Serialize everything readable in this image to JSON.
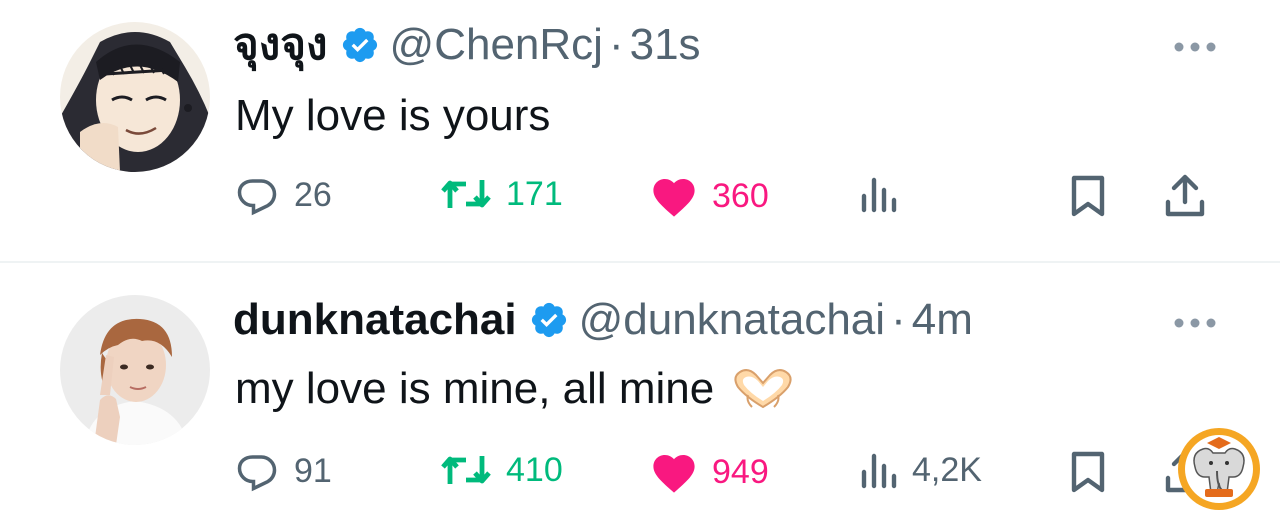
{
  "tweets": [
    {
      "display_name": "จุงจุง",
      "handle": "@ChenRcj",
      "separator": "·",
      "time": "31s",
      "text": "My love is yours",
      "replies": "26",
      "retweets": "171",
      "likes": "360",
      "views": "",
      "liked": true,
      "retweeted": true
    },
    {
      "display_name": "dunknatachai",
      "handle": "@dunknatachai",
      "separator": "·",
      "time": "4m",
      "text": "my love is mine, all mine",
      "emoji": "heart-hands-emoji",
      "replies": "91",
      "retweets": "410",
      "likes": "949",
      "views": "4,2K",
      "liked": true,
      "retweeted": true
    }
  ],
  "colors": {
    "verified": "#1d9bf0",
    "retweet_active": "#00ba7c",
    "like_active": "#f91880",
    "secondary_text": "#536471",
    "divider": "#eff3f4"
  }
}
